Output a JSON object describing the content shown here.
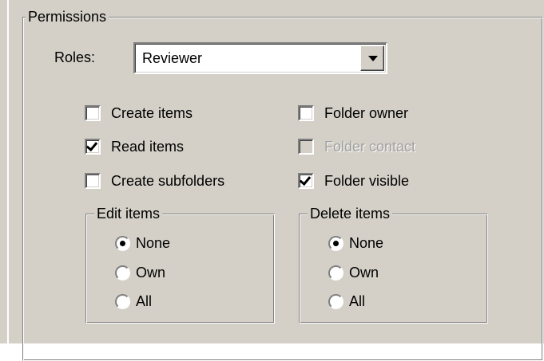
{
  "permissions": {
    "title": "Permissions",
    "roles_label": "Roles:",
    "roles_value": "Reviewer",
    "checkboxes": [
      {
        "label": "Create items",
        "checked": false,
        "disabled": false
      },
      {
        "label": "Read items",
        "checked": true,
        "disabled": false
      },
      {
        "label": "Create subfolders",
        "checked": false,
        "disabled": false
      },
      {
        "label": "Folder owner",
        "checked": false,
        "disabled": false
      },
      {
        "label": "Folder contact",
        "checked": false,
        "disabled": true
      },
      {
        "label": "Folder visible",
        "checked": true,
        "disabled": false
      }
    ],
    "edit_items": {
      "title": "Edit items",
      "options": [
        "None",
        "Own",
        "All"
      ],
      "selected": "None"
    },
    "delete_items": {
      "title": "Delete items",
      "options": [
        "None",
        "Own",
        "All"
      ],
      "selected": "None"
    }
  },
  "icons": {
    "combo_arrow": "chevron-down-icon",
    "checkbox_tick": "checkmark-icon",
    "radio_selected": "radio-dot-icon"
  },
  "colors": {
    "face": "#d4d0c8",
    "shadow": "#808080",
    "highlight": "#ffffff",
    "disabled_text": "#a0a0a0"
  }
}
